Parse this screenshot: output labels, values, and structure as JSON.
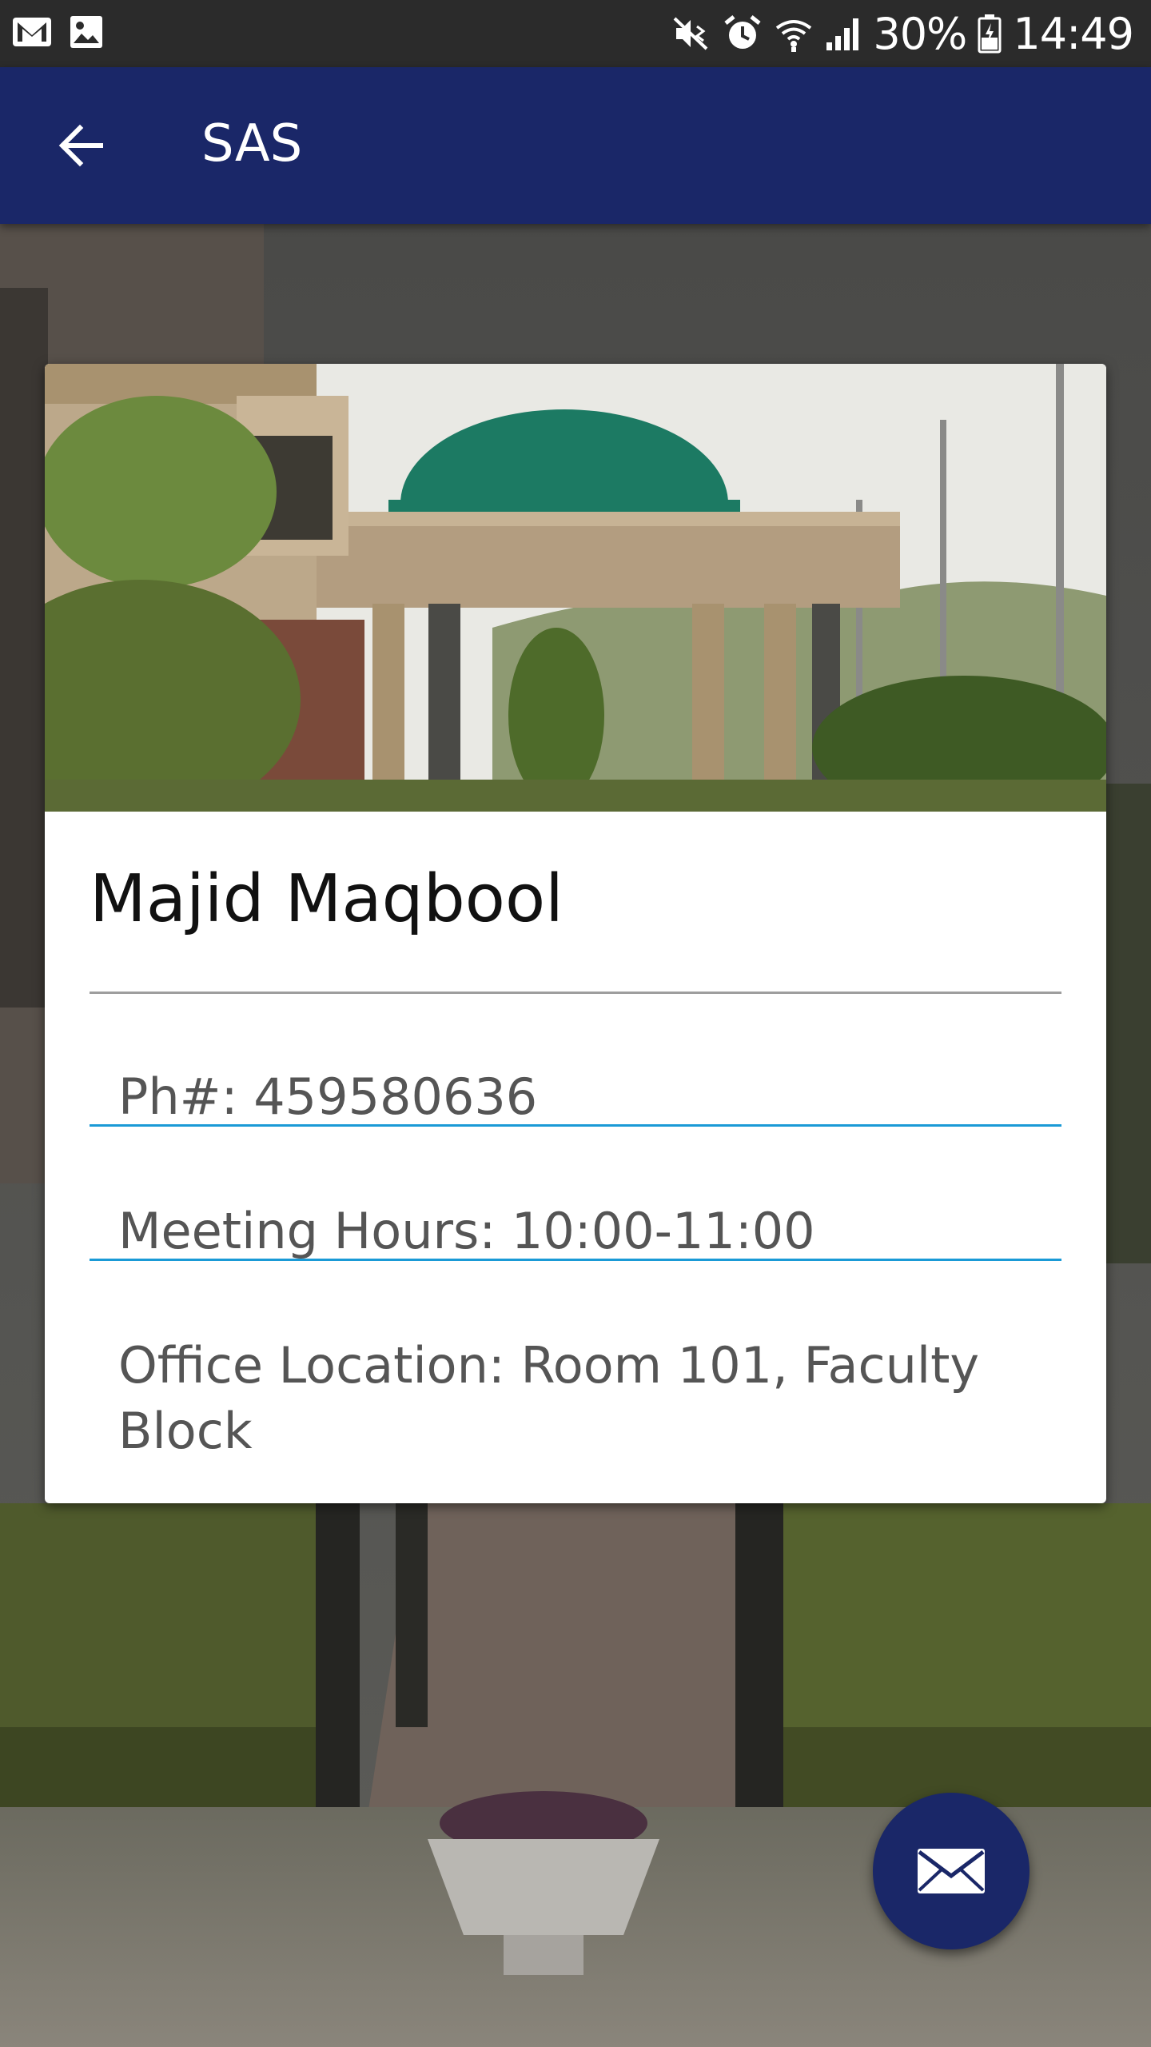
{
  "status_bar": {
    "battery": "30%",
    "time": "14:49",
    "icons": [
      "gmail-icon",
      "image-icon",
      "mute-vibrate-icon",
      "alarm-icon",
      "wifi-icon",
      "signal-icon",
      "battery-icon"
    ]
  },
  "app_bar": {
    "title": "SAS",
    "back_icon": "arrow-back-icon"
  },
  "card": {
    "image": "campus-building-photo",
    "name": "Majid Maqbool",
    "phone": "Ph#: 459580636",
    "meeting_hours": "Meeting Hours: 10:00-11:00",
    "office_location": "Office Location: Room 101, Faculty Block"
  },
  "fab": {
    "icon": "mail-icon"
  },
  "colors": {
    "primary": "#1a2768",
    "status_bar": "#2b2b2b",
    "accent_divider": "#1a9ad6"
  }
}
